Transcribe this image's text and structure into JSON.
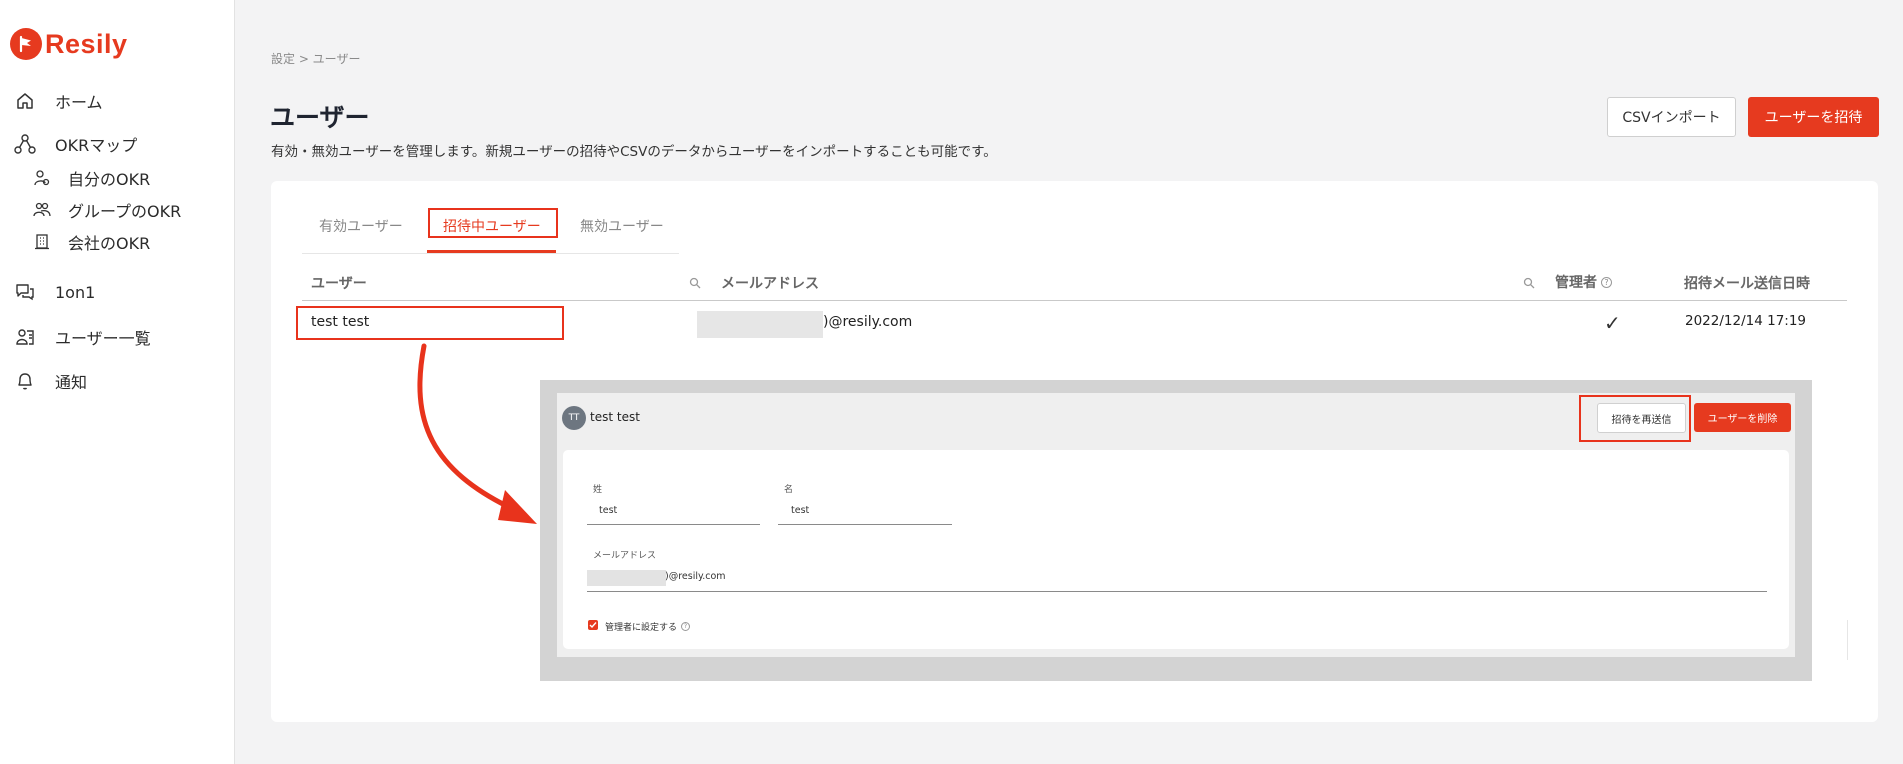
{
  "brand": {
    "name": "Resily",
    "color": "#e63a1f"
  },
  "sidebar": {
    "items": [
      {
        "label": "ホーム",
        "icon": "home-icon"
      },
      {
        "label": "OKRマップ",
        "icon": "okr-map-icon"
      },
      {
        "label": "1on1",
        "icon": "chat-icon"
      },
      {
        "label": "ユーザー一覧",
        "icon": "users-list-icon"
      },
      {
        "label": "通知",
        "icon": "bell-icon"
      }
    ],
    "sub_items": [
      {
        "label": "自分のOKR",
        "icon": "my-okr-icon"
      },
      {
        "label": "グループのOKR",
        "icon": "group-icon"
      },
      {
        "label": "会社のOKR",
        "icon": "building-icon"
      }
    ]
  },
  "header": {
    "breadcrumb": "設定 > ユーザー",
    "title": "ユーザー",
    "description": "有効・無効ユーザーを管理します。新規ユーザーの招待やCSVのデータからユーザーをインポートすることも可能です。",
    "csv_button": "CSVインポート",
    "invite_button": "ユーザーを招待"
  },
  "tabs": [
    {
      "label": "有効ユーザー",
      "active": false
    },
    {
      "label": "招待中ユーザー",
      "active": true
    },
    {
      "label": "無効ユーザー",
      "active": false
    }
  ],
  "table": {
    "columns": [
      "ユーザー",
      "メールアドレス",
      "管理者",
      "招待メール送信日時"
    ],
    "rows": [
      {
        "user": "test test",
        "email": ")@resily.com",
        "admin": "✓",
        "sent_at": "2022/12/14 17:19"
      }
    ]
  },
  "detail": {
    "avatar_initials": "TT",
    "name": "test test",
    "resend_button": "招待を再送信",
    "delete_button": "ユーザーを削除",
    "last_name_label": "姓",
    "last_name_value": "test",
    "first_name_label": "名",
    "first_name_value": "test",
    "email_label": "メールアドレス",
    "email_value": ")@resily.com",
    "admin_checkbox_label": "管理者に設定する",
    "admin_checked": true
  },
  "annotation_color": "#e8331c"
}
